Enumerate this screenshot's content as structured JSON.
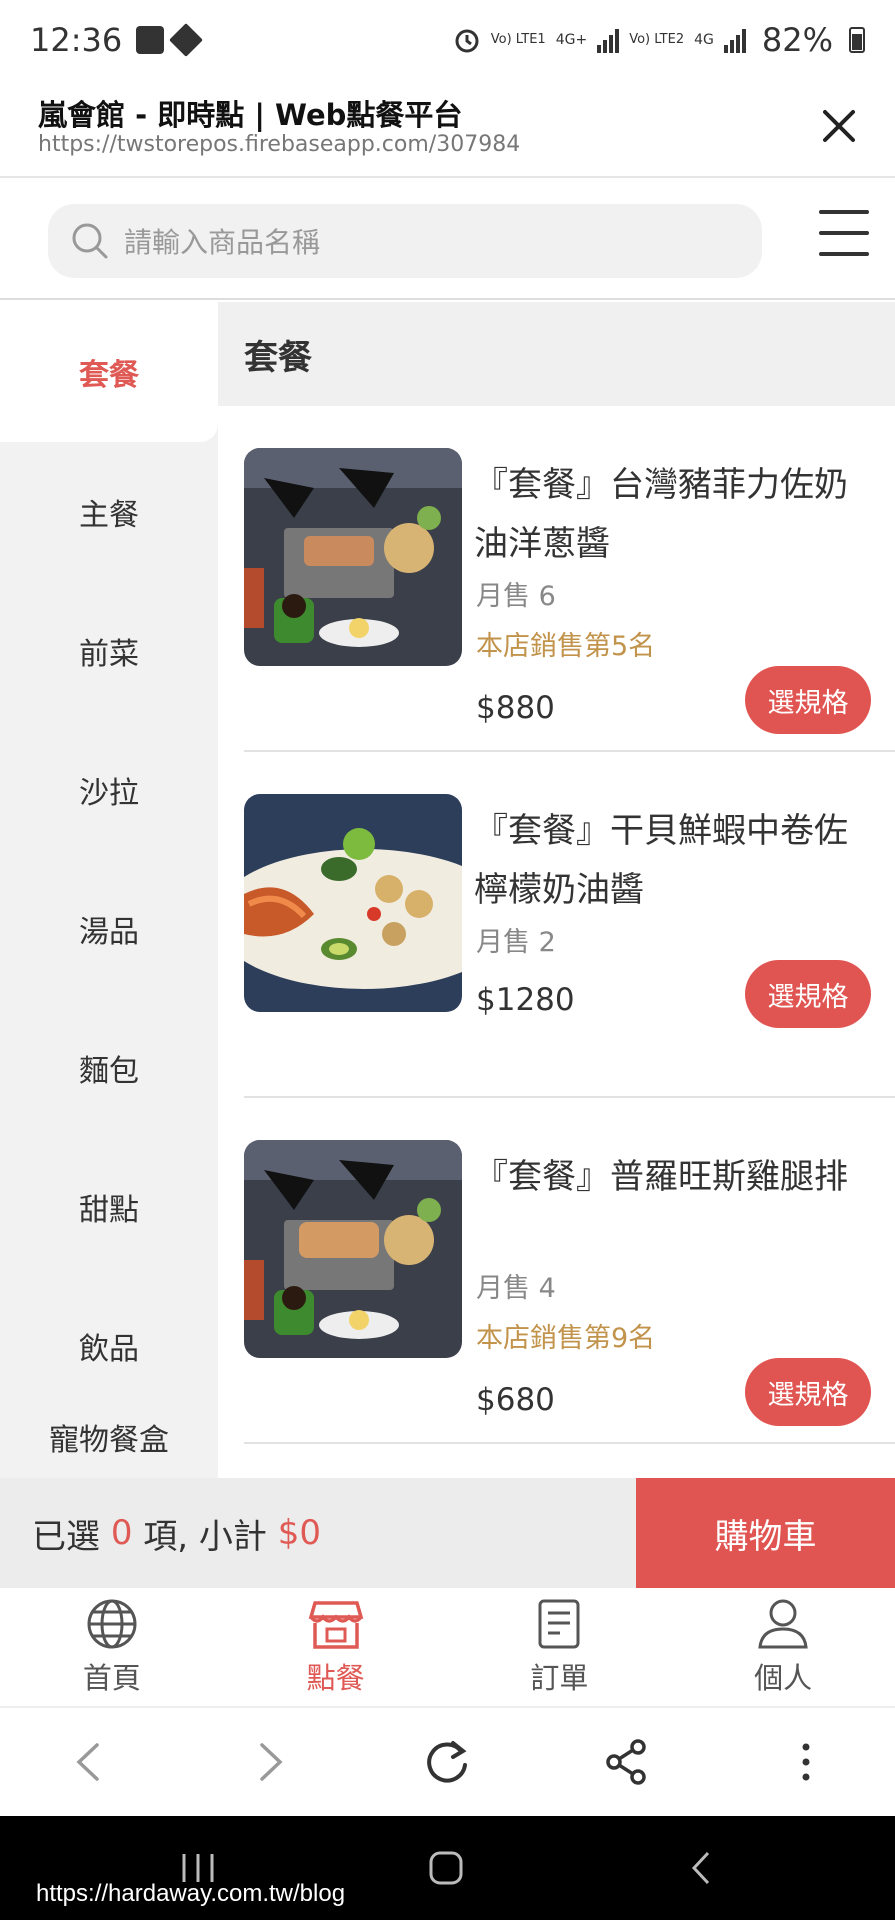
{
  "status_bar": {
    "time": "12:36",
    "net1": "Vo) LTE1",
    "net1_type": "4G+",
    "net2": "Vo) LTE2",
    "net2_type": "4G",
    "battery": "82%"
  },
  "browser": {
    "title": "嵐會館 - 即時點 | Web點餐平台",
    "url": "https://twstorepos.firebaseapp.com/307984"
  },
  "search": {
    "placeholder": "請輸入商品名稱"
  },
  "sidebar": {
    "active": "套餐",
    "items": [
      {
        "label": "主餐"
      },
      {
        "label": "前菜"
      },
      {
        "label": "沙拉"
      },
      {
        "label": "湯品"
      },
      {
        "label": "麵包"
      },
      {
        "label": "甜點"
      },
      {
        "label": "飲品"
      },
      {
        "label": "寵物餐盒"
      }
    ]
  },
  "section": {
    "title": "套餐"
  },
  "products": [
    {
      "name": "『套餐』台灣豬菲力佐奶油洋蔥醬",
      "sold": "月售 6",
      "rank": "本店銷售第5名",
      "price": "$880",
      "button": "選規格"
    },
    {
      "name": "『套餐』干貝鮮蝦中卷佐檸檬奶油醬",
      "sold": "月售 2",
      "price": "$1280",
      "button": "選規格"
    },
    {
      "name": "『套餐』普羅旺斯雞腿排",
      "sold": "月售 4",
      "rank": "本店銷售第9名",
      "price": "$680",
      "button": "選規格"
    }
  ],
  "cart": {
    "prefix": "已選 ",
    "count": "0",
    "middle": " 項, 小計 ",
    "subtotal": "$0",
    "button": "購物車"
  },
  "tabs": [
    {
      "label": "首頁",
      "icon": "globe-icon"
    },
    {
      "label": "點餐",
      "icon": "store-icon",
      "active": true
    },
    {
      "label": "訂單",
      "icon": "receipt-icon"
    },
    {
      "label": "個人",
      "icon": "person-icon"
    }
  ],
  "watermark": "https://hardaway.com.tw/blog",
  "colors": {
    "accent": "#e05551",
    "rank": "#c2934b"
  }
}
